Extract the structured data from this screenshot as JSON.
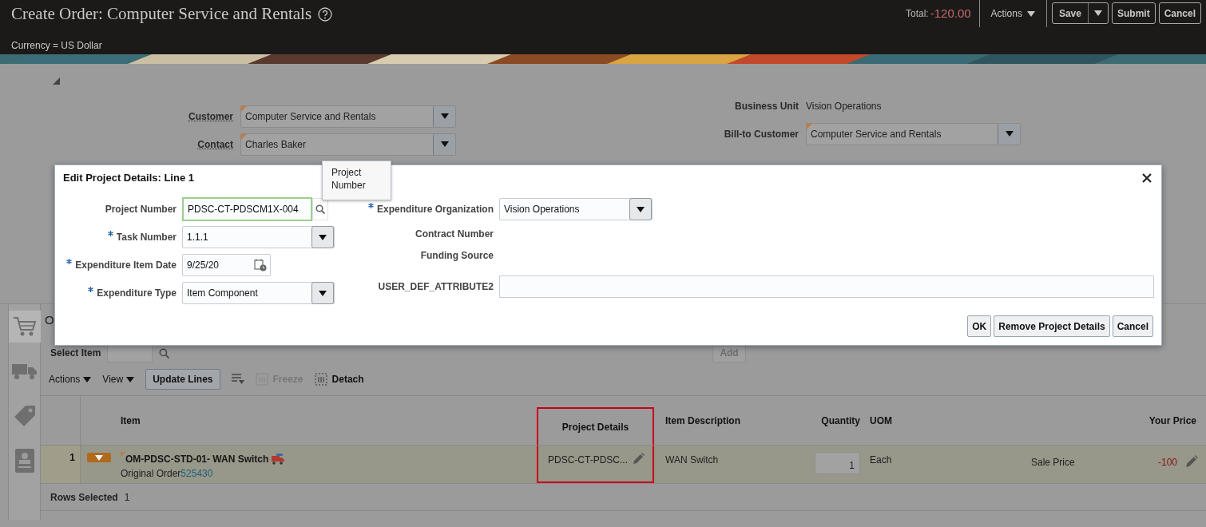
{
  "header": {
    "title": "Create Order: Computer Service and Rentals",
    "currency": "Currency = US Dollar",
    "total_label": "Total:",
    "total": "-120.00",
    "actions": "Actions",
    "buttons": [
      {
        "label": "Save",
        "kind": "split"
      },
      {
        "label": "Submit",
        "kind": "plain"
      },
      {
        "label": "Cancel",
        "kind": "plain"
      }
    ]
  },
  "order_form": {
    "left": [
      {
        "label": "Customer",
        "kind": "select",
        "value": "Computer Service and Rentals"
      },
      {
        "label": "Contact",
        "kind": "select",
        "value": "Charles Baker"
      }
    ],
    "right": [
      {
        "label": "Business Unit",
        "kind": "text",
        "value": "Vision Operations"
      },
      {
        "label": "Bill-to Customer",
        "kind": "select",
        "value": "Computer Service and Rentals"
      }
    ]
  },
  "lines": {
    "heading": "O",
    "side_tabs": [
      {
        "selected": true
      },
      {
        "selected": false
      },
      {
        "selected": false
      },
      {
        "selected": false
      }
    ],
    "select_item": {
      "label": "Select Item"
    },
    "add": "Add",
    "toolbar": [
      {
        "kind": "menu",
        "label": "Actions",
        "disabled": false
      },
      {
        "kind": "menu",
        "label": "View",
        "disabled": false
      },
      {
        "kind": "button",
        "label": "Update Lines",
        "disabled": false
      },
      {
        "kind": "icon",
        "disabled": false
      },
      {
        "kind": "icon_text",
        "label": "Freeze",
        "disabled": true
      },
      {
        "kind": "icon_text",
        "label": "Detach",
        "disabled": false
      }
    ],
    "columns": [
      {
        "label": "Item",
        "highlight": false
      },
      {
        "label": "Project Details",
        "highlight": true
      },
      {
        "label": "Item Description",
        "highlight": false
      },
      {
        "label": "Quantity",
        "highlight": false
      },
      {
        "label": "UOM",
        "highlight": false
      },
      {
        "label": "Your Price",
        "highlight": false
      }
    ],
    "rows": [
      {
        "number": "1",
        "selected": true,
        "item": "OM-PDSC-STD-01- WAN Switch",
        "original_order_label": "Original Order",
        "original_order": "525430",
        "project_details": "PDSC-CT-PDSC...",
        "description": "WAN Switch",
        "quantity": "1",
        "uom": "Each",
        "price_type": "Sale Price",
        "price": "-100"
      }
    ],
    "rows_selected_label": "Rows Selected",
    "rows_selected": "1"
  },
  "dialog": {
    "title": "Edit Project Details: Line 1",
    "tooltip": "Project Number",
    "left": [
      {
        "label": "Project Number",
        "required": false,
        "kind": "search",
        "value": "PDSC-CT-PDSCM1X-004",
        "focused": true
      },
      {
        "label": "Task Number",
        "required": true,
        "kind": "select",
        "value": "1.1.1",
        "focused": false
      },
      {
        "label": "Expenditure Item Date",
        "required": true,
        "kind": "date",
        "value": "9/25/20",
        "focused": false
      },
      {
        "label": "Expenditure Type",
        "required": true,
        "kind": "select",
        "value": "Item Component",
        "focused": false
      }
    ],
    "right": [
      {
        "label": "Expenditure Organization",
        "required": true,
        "kind": "select",
        "value": "Vision Operations",
        "focused": false
      },
      {
        "label": "Contract Number",
        "required": false,
        "kind": "readonly"
      },
      {
        "label": "Funding Source",
        "required": false,
        "kind": "readonly"
      },
      {
        "label": "USER_DEF_ATTRIBUTE2",
        "required": false,
        "kind": "text",
        "focused": false
      }
    ],
    "buttons": [
      "OK",
      "Remove Project Details",
      "Cancel"
    ]
  }
}
